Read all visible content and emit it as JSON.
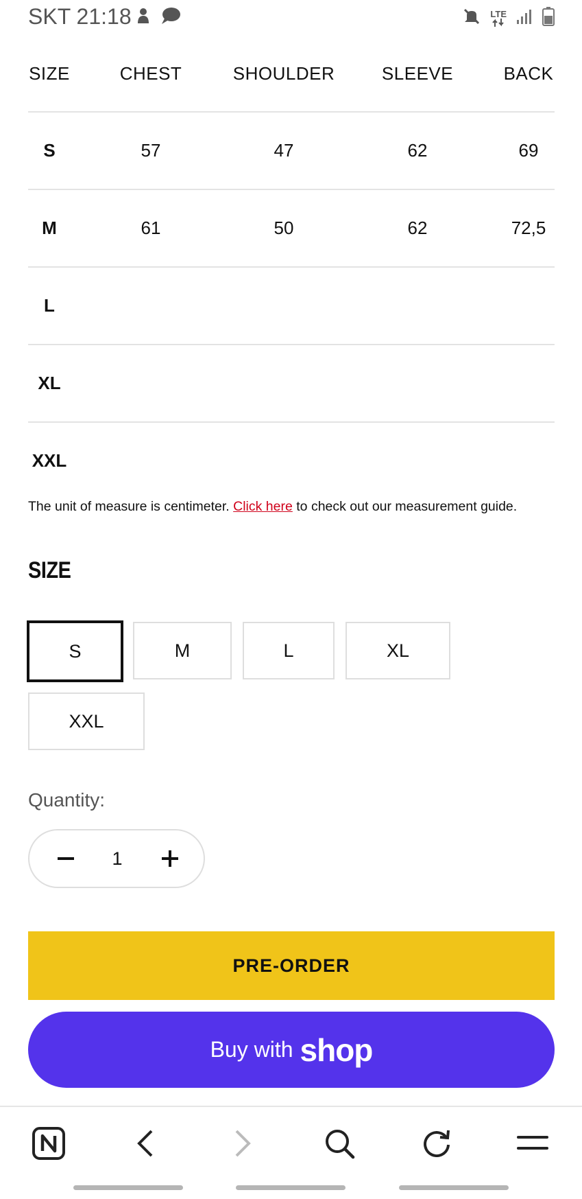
{
  "status_bar": {
    "carrier_time": "SKT 21:18",
    "left_icons": [
      "notification-icon",
      "chat-bubble-icon"
    ],
    "right_icons": [
      "mute-icon",
      "lte-icon",
      "signal-icon",
      "battery-icon"
    ],
    "network_label": "LTE"
  },
  "size_table": {
    "headers": [
      "SIZE",
      "CHEST",
      "SHOULDER",
      "SLEEVE",
      "BACK"
    ],
    "rows": [
      {
        "size": "S",
        "chest": "57",
        "shoulder": "47",
        "sleeve": "62",
        "back": "69"
      },
      {
        "size": "M",
        "chest": "61",
        "shoulder": "50",
        "sleeve": "62",
        "back": "72,5"
      },
      {
        "size": "L",
        "chest": "",
        "shoulder": "",
        "sleeve": "",
        "back": ""
      },
      {
        "size": "XL",
        "chest": "",
        "shoulder": "",
        "sleeve": "",
        "back": ""
      },
      {
        "size": "XXL",
        "chest": "",
        "shoulder": "",
        "sleeve": "",
        "back": ""
      }
    ]
  },
  "unit_note": {
    "before": "The unit of measure is centimeter. ",
    "link": "Click here",
    "after": " to check out our measurement guide."
  },
  "size_selector": {
    "heading": "SIZE",
    "options": [
      "S",
      "M",
      "L",
      "XL",
      "XXL"
    ],
    "selected": "S"
  },
  "quantity": {
    "label": "Quantity:",
    "value": "1"
  },
  "buttons": {
    "preorder": "PRE-ORDER",
    "shop_prefix": "Buy with",
    "shop_brand": "shop"
  },
  "colors": {
    "preorder_bg": "#f0c419",
    "shop_bg": "#5433eb",
    "link": "#d0021b"
  },
  "browser_nav": {
    "icons": [
      "tabs-n-icon",
      "back-arrow-icon",
      "forward-arrow-icon",
      "search-icon",
      "reload-icon",
      "menu-icon"
    ]
  }
}
